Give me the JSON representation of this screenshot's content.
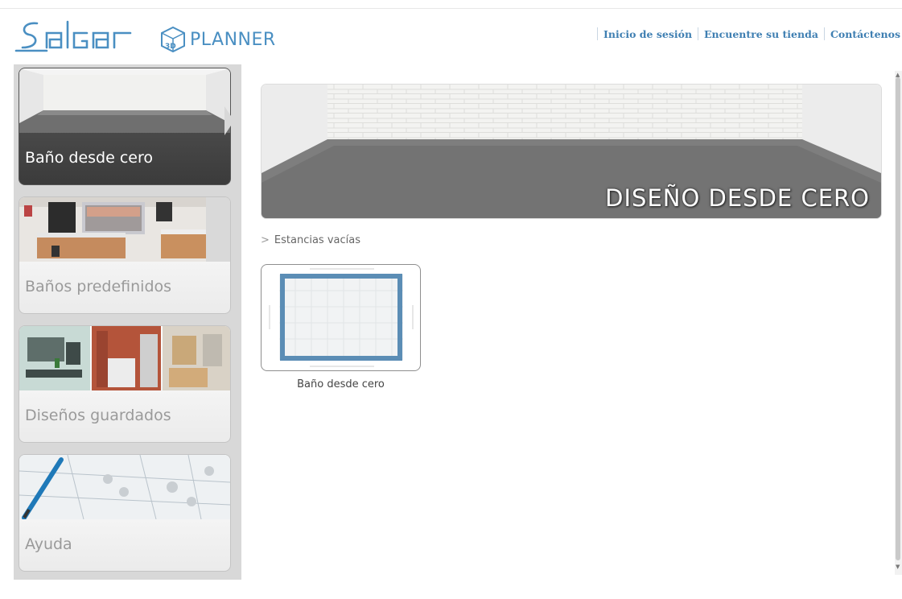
{
  "header": {
    "brand": "Salgar",
    "product": "PLANNER",
    "cube_label": "3D",
    "nav": [
      {
        "label": "Inicio de sesión"
      },
      {
        "label": "Encuentre su tienda"
      },
      {
        "label": "Contáctenos"
      }
    ]
  },
  "sidebar": {
    "items": [
      {
        "label": "Baño desde cero",
        "active": true
      },
      {
        "label": "Baños predefinidos",
        "active": false
      },
      {
        "label": "Diseños guardados",
        "active": false
      },
      {
        "label": "Ayuda",
        "active": false
      }
    ]
  },
  "main": {
    "banner_text": "DISEÑO DESDE CERO",
    "breadcrumb": "Estancias vacías",
    "tiles": [
      {
        "label": "Baño desde cero"
      }
    ]
  },
  "colors": {
    "brand_blue": "#4a8fc2",
    "link_blue": "#3f7fb2",
    "active_card": "#474747",
    "room_outline": "#5b8db5"
  }
}
